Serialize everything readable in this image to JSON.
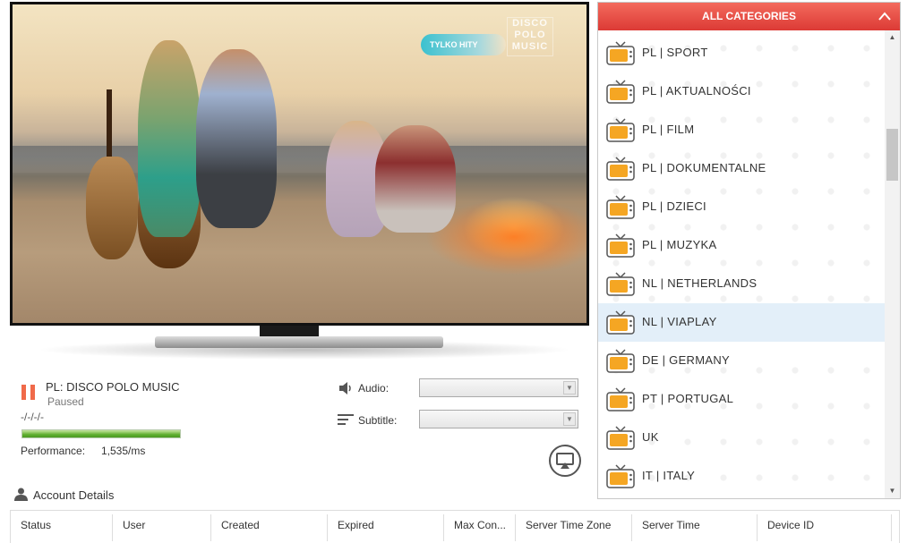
{
  "video": {
    "badge": "TYLKO HITY",
    "logo_text": "DISCO POLO MUSIC"
  },
  "player": {
    "channel_name": "PL: DISCO POLO MUSIC",
    "status": "Paused",
    "time": "-/-/-/-",
    "performance_label": "Performance:",
    "performance_value": "1,535/ms",
    "performance_fraction": 1.0,
    "audio_label": "Audio:",
    "audio_value": "",
    "subtitle_label": "Subtitle:",
    "subtitle_value": ""
  },
  "account": {
    "title": "Account Details",
    "columns": [
      "Status",
      "User",
      "Created",
      "Expired",
      "Max Con...",
      "Server Time Zone",
      "Server Time",
      "Device ID"
    ]
  },
  "categories": {
    "header": "ALL CATEGORIES",
    "items": [
      {
        "label": "PL  |  SPORT"
      },
      {
        "label": "PL  |  AKTUALNOŚCI"
      },
      {
        "label": "PL  |  FILM"
      },
      {
        "label": "PL  |  DOKUMENTALNE"
      },
      {
        "label": "PL  |  DZIECI"
      },
      {
        "label": "PL  |  MUZYKA"
      },
      {
        "label": "NL  |  NETHERLANDS"
      },
      {
        "label": "NL  |  VIAPLAY",
        "selected": true
      },
      {
        "label": "DE  |  GERMANY"
      },
      {
        "label": "PT  |  PORTUGAL"
      },
      {
        "label": "UK"
      },
      {
        "label": "IT  |  ITALY"
      }
    ]
  },
  "colors": {
    "accent_red": "#e0433b",
    "pause_orange": "#f06a4a",
    "tv_icon_orange": "#f5a623",
    "selected_row": "#e3eff9",
    "performance_green": "#5fae2e"
  },
  "icons": {
    "pause": "pause-icon",
    "audio": "speaker-icon",
    "subtitle": "subtitle-lines-icon",
    "cast": "airplay-icon",
    "account": "user-icon",
    "category": "tv-icon",
    "collapse": "chevron-up-icon"
  }
}
